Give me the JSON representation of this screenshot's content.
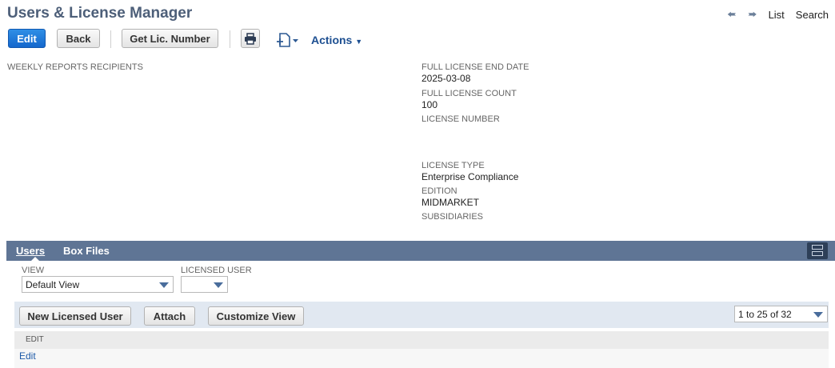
{
  "header": {
    "title": "Users & License Manager",
    "nav": {
      "list": "List",
      "search": "Search"
    }
  },
  "toolbar": {
    "edit": "Edit",
    "back": "Back",
    "get_lic_number": "Get Lic. Number",
    "actions": "Actions"
  },
  "fields": {
    "weekly_reports_recipients": {
      "label": "WEEKLY REPORTS RECIPIENTS",
      "value": ""
    },
    "full_license_end_date": {
      "label": "FULL LICENSE END DATE",
      "value": "2025-03-08"
    },
    "full_license_count": {
      "label": "FULL LICENSE COUNT",
      "value": "100"
    },
    "license_number": {
      "label": "LICENSE NUMBER",
      "value": ""
    },
    "license_type": {
      "label": "LICENSE TYPE",
      "value": "Enterprise Compliance"
    },
    "edition": {
      "label": "EDITION",
      "value": "MIDMARKET"
    },
    "subsidiaries": {
      "label": "SUBSIDIARIES",
      "value": ""
    }
  },
  "tabs": [
    {
      "label": "Users",
      "active": true
    },
    {
      "label": "Box Files",
      "active": false
    }
  ],
  "filters": {
    "view": {
      "label": "VIEW",
      "value": "Default View"
    },
    "licensed_user": {
      "label": "LICENSED USER",
      "value": ""
    }
  },
  "sublist": {
    "buttons": {
      "new_licensed_user": "New Licensed User",
      "attach": "Attach",
      "customize_view": "Customize View"
    },
    "pagination": "1 to 25 of 32",
    "columns": [
      "EDIT"
    ],
    "rows": [
      {
        "edit": "Edit"
      }
    ]
  },
  "colors": {
    "title": "#4d5f79",
    "primary_button": "#1467cc",
    "tab_bar": "#5f7595",
    "sublist_bar": "#e1e8f1",
    "link": "#1d5aa8"
  }
}
